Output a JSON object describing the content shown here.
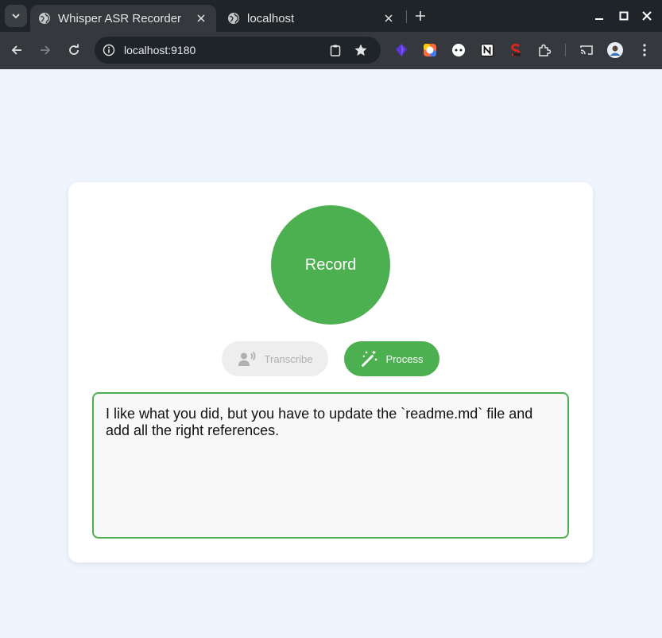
{
  "browser": {
    "tabs": [
      {
        "title": "Whisper ASR Recorder",
        "active": true,
        "icon": "globe-icon"
      },
      {
        "title": "localhost",
        "active": false,
        "icon": "globe-icon"
      }
    ],
    "address": "localhost:9180",
    "extensions": [
      "obsidian-icon",
      "color-ring-icon",
      "dots-circle-icon",
      "notion-icon",
      "seo-icon",
      "puzzle-icon"
    ],
    "colors": {
      "tabstrip": "#1f2428",
      "toolbar": "#35393d",
      "omnibox": "#1f2428"
    }
  },
  "app": {
    "record_label": "Record",
    "transcribe_label": "Transcribe",
    "process_label": "Process",
    "transcript": "I like what you did, but you have to update the `readme.md` file and add all the right references.",
    "colors": {
      "accent": "#4caf50",
      "disabled_bg": "#eeeeee",
      "disabled_text": "#b0b0b0",
      "page_bg": "#eef5ff"
    }
  }
}
